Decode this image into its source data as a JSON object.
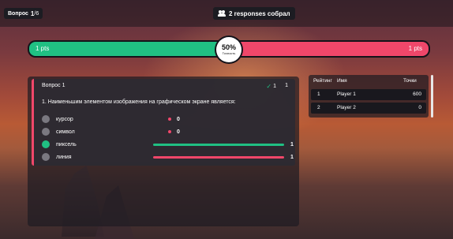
{
  "header": {
    "question_label": "Вопрос",
    "question_current": "1",
    "question_total": "/6",
    "responses_text": "2 responses собрал"
  },
  "accuracy": {
    "correct_points": "1 pts",
    "wrong_points": "1 pts",
    "percent": "50%",
    "percent_value": 50,
    "label": "Точность"
  },
  "question": {
    "title": "Вопрос 1",
    "correct_count": "1",
    "score": "1",
    "text": "1.  Наименьшим элементом изображения на графическом экране является:",
    "options": [
      {
        "label": "курсор",
        "count": "0",
        "correct": false
      },
      {
        "label": "символ",
        "count": "0",
        "correct": false
      },
      {
        "label": "пиксель",
        "count": "1",
        "correct": true
      },
      {
        "label": "линия",
        "count": "1",
        "correct": false
      }
    ]
  },
  "leaderboard": {
    "col_rank": "Рейтинг",
    "col_name": "Имя",
    "col_points": "Точки",
    "rows": [
      {
        "rank": "1",
        "name": "Player 1",
        "points": "600"
      },
      {
        "rank": "2",
        "name": "Player 2",
        "points": "0"
      }
    ]
  },
  "colors": {
    "correct": "#20c083",
    "wrong": "#f0476a",
    "panel": "#1e1c22"
  },
  "icons": {
    "responses": "users-icon",
    "correct_check": "check-icon"
  }
}
